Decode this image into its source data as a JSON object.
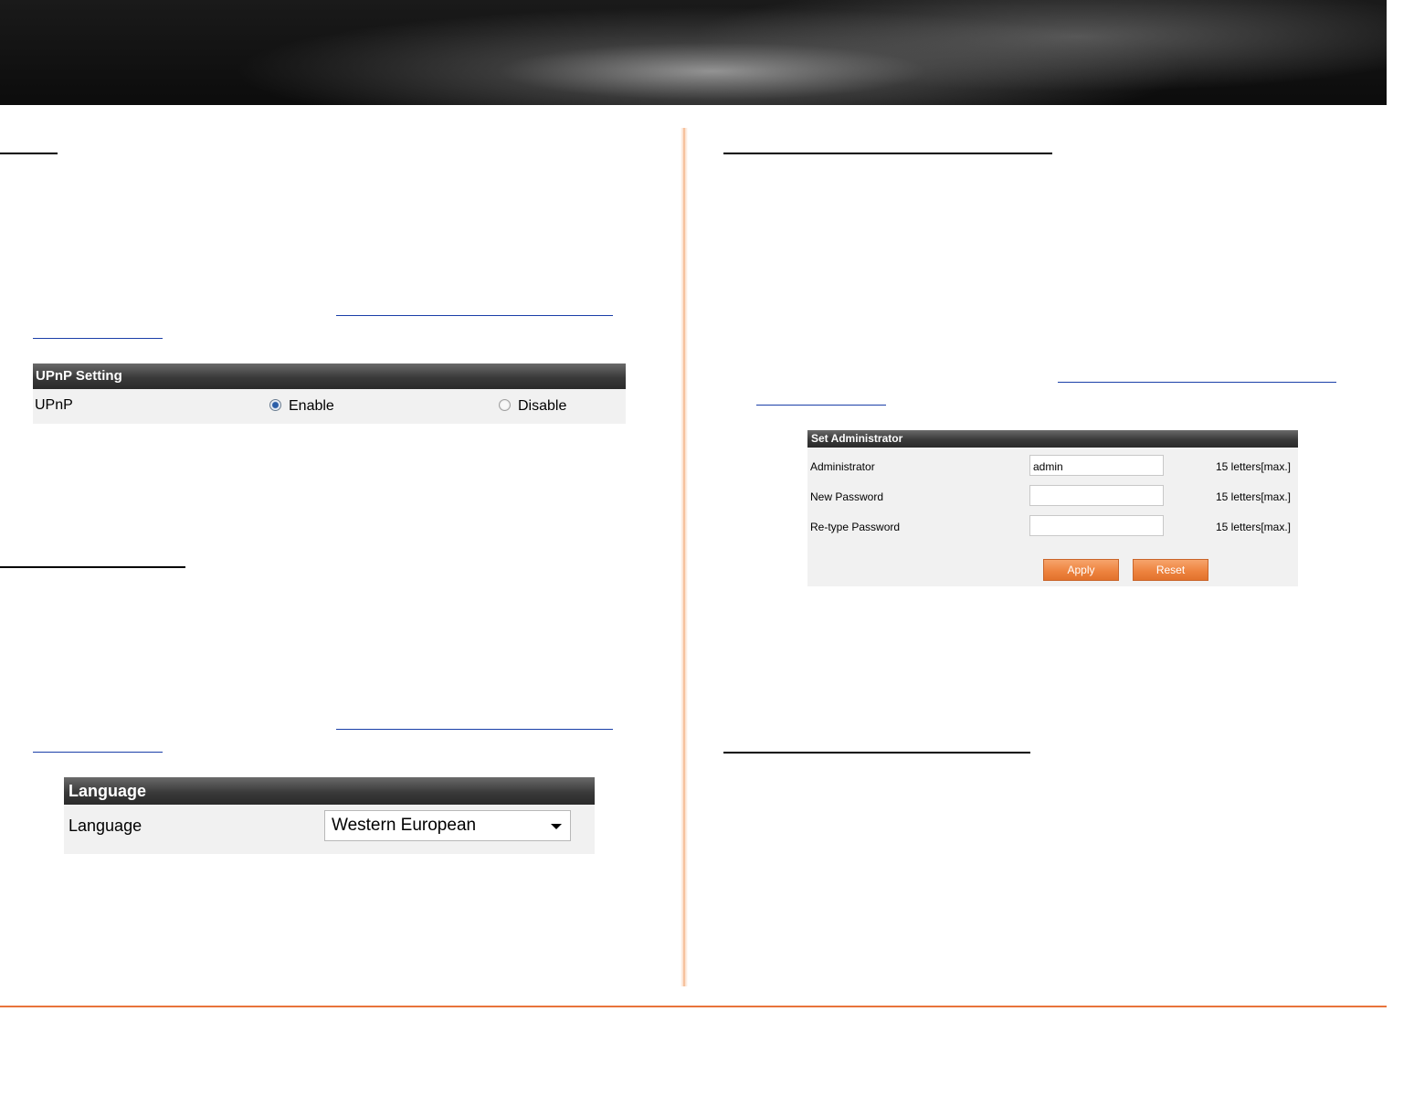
{
  "upnp_setting": {
    "title": "UPnP Setting",
    "label": "UPnP",
    "options": [
      {
        "label": "Enable",
        "selected": true
      },
      {
        "label": "Disable",
        "selected": false
      }
    ]
  },
  "set_administrator": {
    "title": "Set Administrator",
    "rows": [
      {
        "label": "Administrator",
        "value": "admin",
        "hint": "15 letters[max.]"
      },
      {
        "label": "New Password",
        "value": "",
        "hint": "15 letters[max.]"
      },
      {
        "label": "Re-type Password",
        "value": "",
        "hint": "15 letters[max.]"
      }
    ],
    "apply_label": "Apply",
    "reset_label": "Reset"
  },
  "language": {
    "title": "Language",
    "label": "Language",
    "selected": "Western European"
  },
  "colors": {
    "accent": "#e8743b",
    "panel_header": "#3a3a3a",
    "panel_body": "#f1f1f1",
    "link": "#1a3fa8"
  }
}
